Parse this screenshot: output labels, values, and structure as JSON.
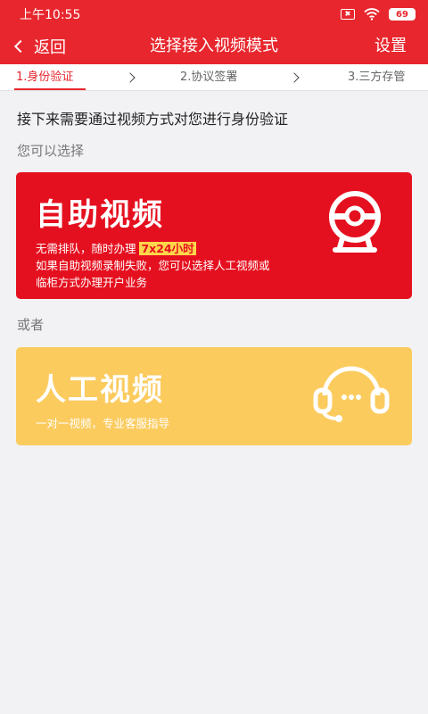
{
  "status_bar": {
    "time": "上午10:55",
    "battery": "69"
  },
  "nav": {
    "back_label": "返回",
    "title": "选择接入视频模式",
    "settings_label": "设置"
  },
  "steps": [
    {
      "label": "1.身份验证",
      "active": true
    },
    {
      "label": "2.协议签署",
      "active": false
    },
    {
      "label": "3.三方存管",
      "active": false
    }
  ],
  "content": {
    "intro": "接下来需要通过视频方式对您进行身份验证",
    "choose_hint": "您可以选择",
    "or_label": "或者"
  },
  "self_video": {
    "title": "自助视频",
    "line1_prefix": "无需排队，随时办理 ",
    "line1_highlight": "7x24小时",
    "line2": "如果自助视频录制失败，您可以选择人工视频或",
    "line3": "临柜方式办理开户业务",
    "icon": "webcam-icon"
  },
  "manual_video": {
    "title": "人工视频",
    "desc": "一对一视频，专业客服指导",
    "icon": "headset-icon"
  },
  "colors": {
    "brand_red": "#e8262d",
    "card_red": "#e5101f",
    "card_yellow": "#fbcb5e",
    "highlight": "#ffd54a"
  }
}
